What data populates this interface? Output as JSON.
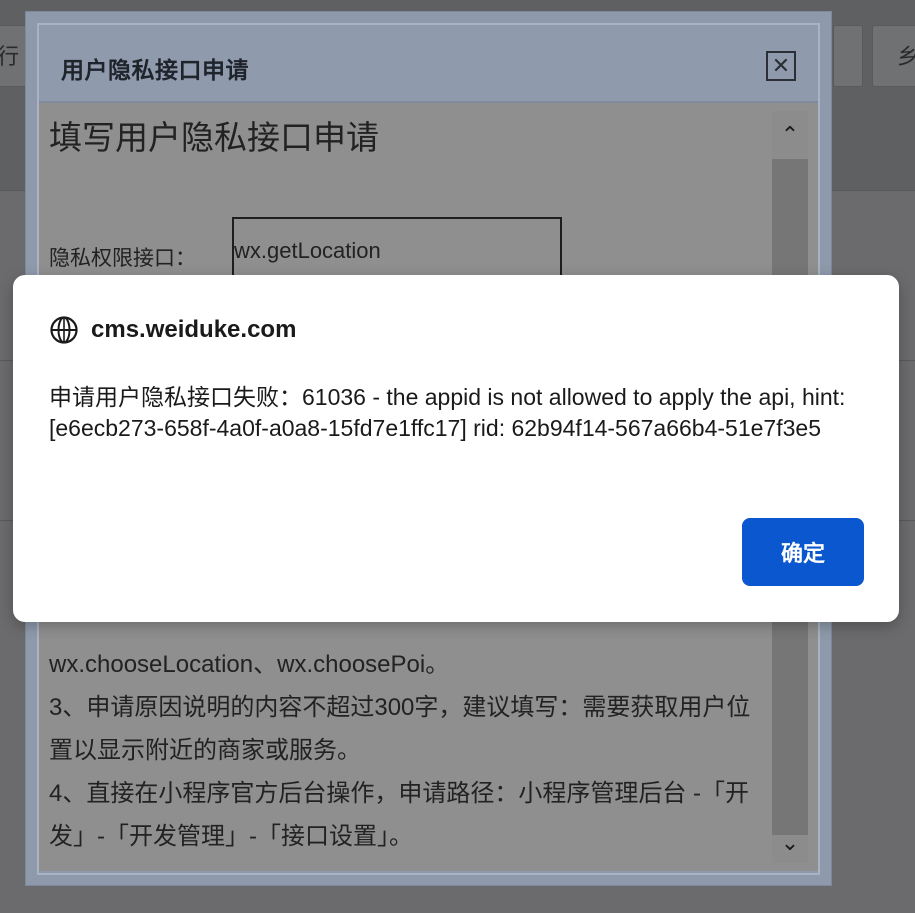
{
  "background": {
    "tab_left_label": "行",
    "tab_right_label": "乡"
  },
  "dialog": {
    "title": "用户隐私接口申请",
    "close_symbol": "✕",
    "heading": "填写用户隐私接口申请",
    "field_label": "隐私权限接口：",
    "field_value": "wx.getLocation",
    "notes": [
      "wx.chooseLocation、wx.choosePoi。",
      "3、申请原因说明的内容不超过300字，建议填写：需要获取用户位置以显示附近的商家或服务。",
      "4、直接在小程序官方后台操作，申请路径：小程序管理后台 -「开发」-「开发管理」-「接口设置」。"
    ],
    "scroll_up_symbol": "⌃",
    "scroll_down_symbol": "⌄"
  },
  "alert": {
    "origin": "cms.weiduke.com",
    "icon": "globe-icon",
    "message": "申请用户隐私接口失败：61036 - the appid is not allowed to apply the api, hint: [e6ecb273-658f-4a0f-a0a8-15fd7e1ffc17] rid: 62b94f14-567a66b4-51e7f3e5",
    "ok_label": "确定",
    "ok_color": "#0b57d0"
  }
}
